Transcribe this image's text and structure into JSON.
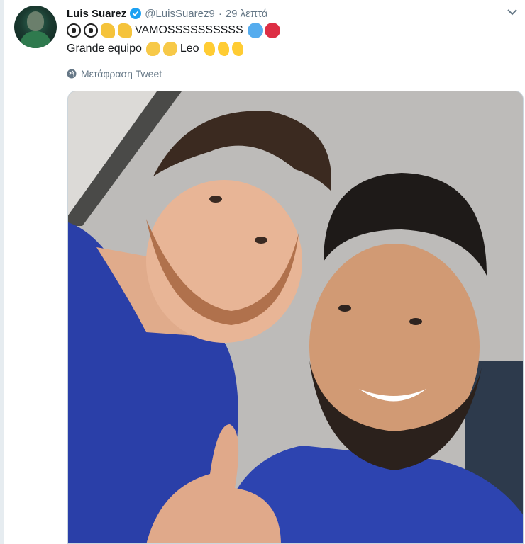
{
  "tweet": {
    "author_name": "Luis Suarez",
    "handle": "@LuisSuarez9",
    "separator": "·",
    "time": "29 λεπτά",
    "line1_text": "VAMOSSSSSSSSSS",
    "line2_text_a": "Grande equipo",
    "line2_text_b": "Leo",
    "translate_label": "Μετάφραση Tweet"
  },
  "icons": {
    "avatar": "profile-photo",
    "verified": "verified-badge-icon",
    "caret": "chevron-down-icon",
    "globe": "globe-icon",
    "emoji_line1": [
      "soccer-ball",
      "soccer-ball",
      "flexed-biceps",
      "flexed-biceps",
      "blue-circle",
      "red-circle"
    ],
    "emoji_line2": [
      "clapping-hands",
      "clapping-hands",
      "ok-hand",
      "ok-hand",
      "ok-hand"
    ]
  },
  "colors": {
    "verified": "#1da1f2",
    "secondary_text": "#657786",
    "blue_circle": "#55acee",
    "red_circle": "#dd2e44",
    "jersey": "#2a3fa8"
  }
}
